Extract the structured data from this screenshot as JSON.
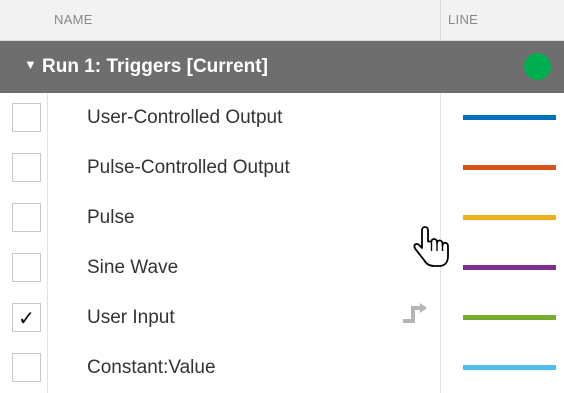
{
  "header": {
    "name_label": "NAME",
    "line_label": "LINE"
  },
  "run": {
    "title": "Run 1: Triggers [Current]",
    "status_color": "#00b050",
    "expanded": true
  },
  "signals": [
    {
      "name": "User-Controlled Output",
      "checked": false,
      "checkmark": "",
      "color": "#0072bd"
    },
    {
      "name": "Pulse-Controlled Output",
      "checked": false,
      "checkmark": "",
      "color": "#d95319"
    },
    {
      "name": "Pulse",
      "checked": false,
      "checkmark": "",
      "color": "#edb120"
    },
    {
      "name": "Sine Wave",
      "checked": false,
      "checkmark": "",
      "color": "#7e2f8e"
    },
    {
      "name": "User Input",
      "checked": true,
      "checkmark": "✓",
      "color": "#77ac30",
      "trigger_icon": "trigger-icon"
    },
    {
      "name": "Constant:Value",
      "checked": false,
      "checkmark": "",
      "color": "#4dbeee"
    }
  ],
  "cursor": "hand-pointer-icon"
}
